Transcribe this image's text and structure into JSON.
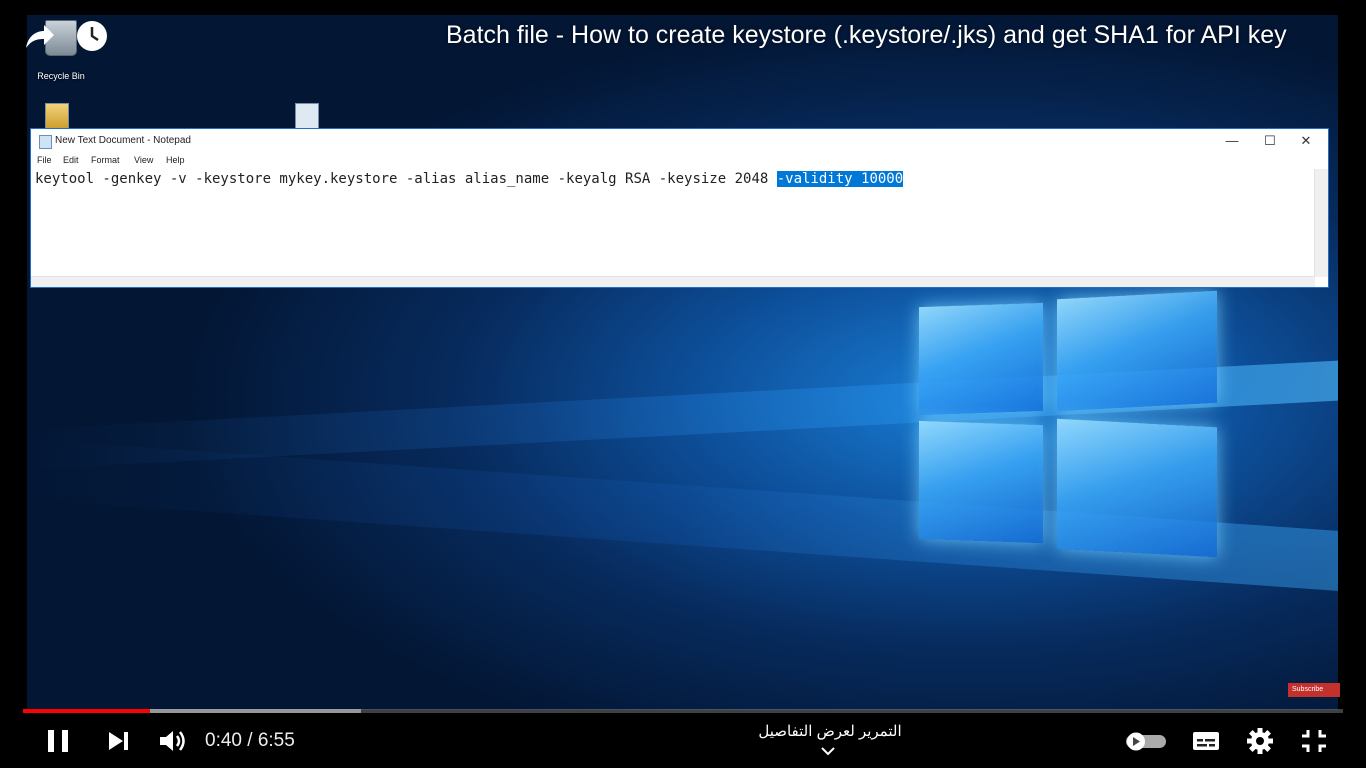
{
  "video": {
    "title": "Batch file - How to create keystore (.keystore/.jks) and get SHA1 for API key",
    "current_time": "0:40",
    "duration": "6:55",
    "time_separator": " / ",
    "progress_fraction": 0.0964,
    "buffered_fraction": 0.256,
    "scroll_hint": "التمرير لعرض التفاصيل",
    "subscribe_badge": "Subscribe"
  },
  "desktop": {
    "recycle_bin_label": "Recycle Bin"
  },
  "notepad": {
    "window_title": "New Text Document - Notepad",
    "menu": [
      "File",
      "Edit",
      "Format",
      "View",
      "Help"
    ],
    "content_plain": "keytool -genkey -v -keystore mykey.keystore -alias alias_name -keyalg RSA -keysize 2048 ",
    "content_selected": "-validity 10000",
    "selection_color": "#0078d7"
  },
  "player_controls": {
    "icons": [
      "pause-icon",
      "next-icon",
      "volume-icon",
      "autoplay-toggle-icon",
      "subtitles-icon",
      "settings-icon",
      "exit-fullscreen-icon"
    ],
    "accent": "#ff0000"
  }
}
